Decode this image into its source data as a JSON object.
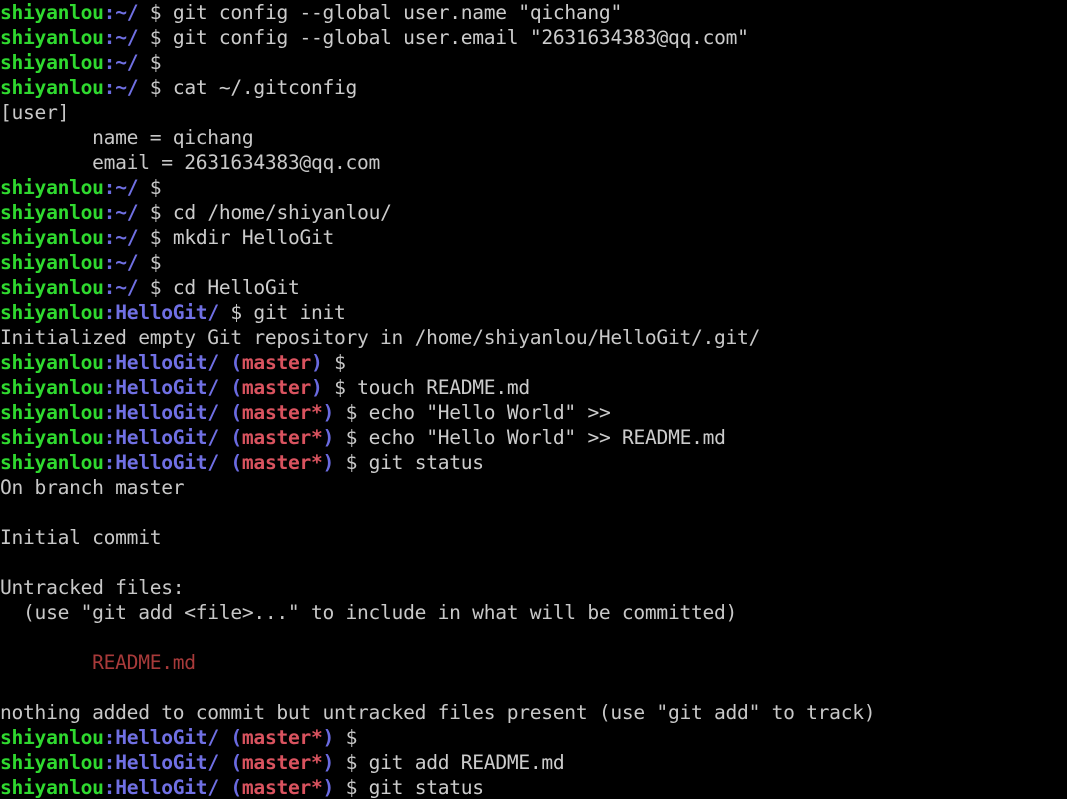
{
  "terminal": {
    "title": "shiyanlou terminal",
    "background": "#000000",
    "colors": {
      "host": "#2fd92f",
      "path": "#7070e4",
      "colon": "#6a6ae0",
      "paren": "#6a6ae0",
      "branch": "#d9535f",
      "output": "#c8c8c8",
      "untracked_file": "#a83a3a",
      "prompt_symbol": "#c8c8c8"
    },
    "user": "shiyanlou",
    "git_user_name": "qichang",
    "git_user_email": "2631634383@qq.com",
    "repo_dir": "HelloGit",
    "home_dir": "/home/shiyanlou",
    "branch": "master",
    "lines": [
      {
        "type": "prompt",
        "host": "shiyanlou",
        "colon": ":",
        "path": "~/",
        "branch": "",
        "sym": "$",
        "cmd": " git config --global user.name \"qichang\""
      },
      {
        "type": "prompt",
        "host": "shiyanlou",
        "colon": ":",
        "path": "~/",
        "branch": "",
        "sym": "$",
        "cmd": " git config --global user.email \"2631634383@qq.com\""
      },
      {
        "type": "prompt",
        "host": "shiyanlou",
        "colon": ":",
        "path": "~/",
        "branch": "",
        "sym": "$",
        "cmd": ""
      },
      {
        "type": "prompt",
        "host": "shiyanlou",
        "colon": ":",
        "path": "~/",
        "branch": "",
        "sym": "$",
        "cmd": " cat ~/.gitconfig"
      },
      {
        "type": "output",
        "text": "[user]"
      },
      {
        "type": "output",
        "text": "        name = qichang"
      },
      {
        "type": "output",
        "text": "        email = 2631634383@qq.com"
      },
      {
        "type": "prompt",
        "host": "shiyanlou",
        "colon": ":",
        "path": "~/",
        "branch": "",
        "sym": "$",
        "cmd": ""
      },
      {
        "type": "prompt",
        "host": "shiyanlou",
        "colon": ":",
        "path": "~/",
        "branch": "",
        "sym": "$",
        "cmd": " cd /home/shiyanlou/"
      },
      {
        "type": "prompt",
        "host": "shiyanlou",
        "colon": ":",
        "path": "~/",
        "branch": "",
        "sym": "$",
        "cmd": " mkdir HelloGit"
      },
      {
        "type": "prompt",
        "host": "shiyanlou",
        "colon": ":",
        "path": "~/",
        "branch": "",
        "sym": "$",
        "cmd": ""
      },
      {
        "type": "prompt",
        "host": "shiyanlou",
        "colon": ":",
        "path": "~/",
        "branch": "",
        "sym": "$",
        "cmd": " cd HelloGit"
      },
      {
        "type": "prompt",
        "host": "shiyanlou",
        "colon": ":",
        "path": "HelloGit/",
        "branch": "",
        "sym": "$",
        "cmd": " git init"
      },
      {
        "type": "output",
        "text": "Initialized empty Git repository in /home/shiyanlou/HelloGit/.git/"
      },
      {
        "type": "prompt",
        "host": "shiyanlou",
        "colon": ":",
        "path": "HelloGit/",
        "branch": "master",
        "sym": "$",
        "cmd": ""
      },
      {
        "type": "prompt",
        "host": "shiyanlou",
        "colon": ":",
        "path": "HelloGit/",
        "branch": "master",
        "sym": "$",
        "cmd": " touch README.md"
      },
      {
        "type": "prompt",
        "host": "shiyanlou",
        "colon": ":",
        "path": "HelloGit/",
        "branch": "master*",
        "sym": "$",
        "cmd": " echo \"Hello World\" >>"
      },
      {
        "type": "prompt",
        "host": "shiyanlou",
        "colon": ":",
        "path": "HelloGit/",
        "branch": "master*",
        "sym": "$",
        "cmd": " echo \"Hello World\" >> README.md"
      },
      {
        "type": "prompt",
        "host": "shiyanlou",
        "colon": ":",
        "path": "HelloGit/",
        "branch": "master*",
        "sym": "$",
        "cmd": " git status"
      },
      {
        "type": "output",
        "text": "On branch master"
      },
      {
        "type": "output",
        "text": ""
      },
      {
        "type": "output",
        "text": "Initial commit"
      },
      {
        "type": "output",
        "text": ""
      },
      {
        "type": "output",
        "text": "Untracked files:"
      },
      {
        "type": "output",
        "text": "  (use \"git add <file>...\" to include in what will be committed)"
      },
      {
        "type": "output",
        "text": ""
      },
      {
        "type": "file",
        "text": "        README.md"
      },
      {
        "type": "output",
        "text": ""
      },
      {
        "type": "output",
        "text": "nothing added to commit but untracked files present (use \"git add\" to track)"
      },
      {
        "type": "prompt",
        "host": "shiyanlou",
        "colon": ":",
        "path": "HelloGit/",
        "branch": "master*",
        "sym": "$",
        "cmd": ""
      },
      {
        "type": "prompt",
        "host": "shiyanlou",
        "colon": ":",
        "path": "HelloGit/",
        "branch": "master*",
        "sym": "$",
        "cmd": " git add README.md"
      },
      {
        "type": "prompt",
        "host": "shiyanlou",
        "colon": ":",
        "path": "HelloGit/",
        "branch": "master*",
        "sym": "$",
        "cmd": " git status"
      }
    ]
  }
}
